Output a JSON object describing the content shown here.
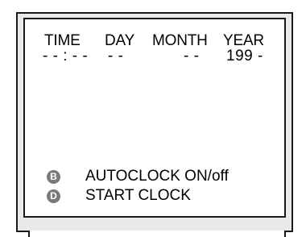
{
  "screen": {
    "headers": {
      "time": "TIME",
      "day": "DAY",
      "month": "MONTH",
      "year": "YEAR"
    },
    "values": {
      "time": "- - : - -",
      "day": "- -",
      "month": "- -",
      "year": "199 -"
    }
  },
  "options": [
    {
      "key": "B",
      "label": "AUTOCLOCK ON/off",
      "icon": "circle-b-icon"
    },
    {
      "key": "D",
      "label": "START CLOCK",
      "icon": "circle-d-icon"
    }
  ],
  "colors": {
    "badge": "#7a7a7a",
    "bezel": "#e9e9e9",
    "screen": "#ffffff"
  }
}
